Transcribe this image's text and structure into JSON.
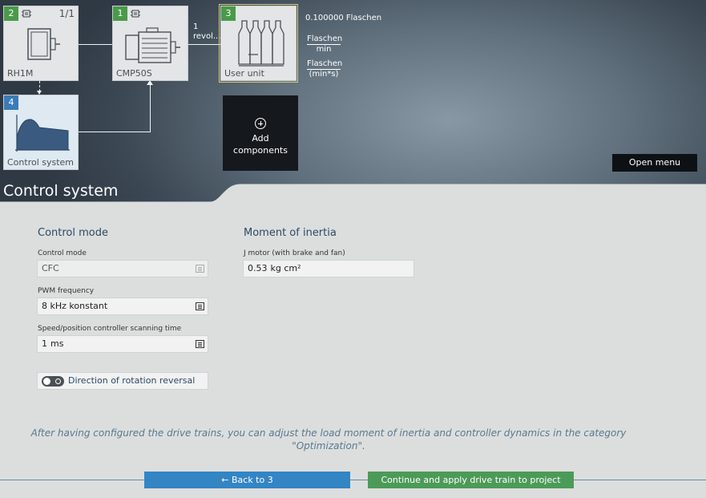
{
  "cards": {
    "encoder": {
      "num": "2",
      "label": "RH1M",
      "frac": "1/1"
    },
    "motor": {
      "num": "1",
      "label": "CMP50S"
    },
    "user_unit": {
      "num": "3",
      "label": "User unit"
    },
    "control_system": {
      "num": "4",
      "label": "Control system"
    }
  },
  "link_text": {
    "line1": "1",
    "line2": "revol..."
  },
  "user_unit_values": {
    "quantity": "0.100000 Flaschen",
    "rate_num": "Flaschen",
    "rate_den": "min",
    "accel_num": "Flaschen",
    "accel_den": "(min*s)"
  },
  "add_components": {
    "line1": "Add",
    "line2": "components"
  },
  "open_menu_label": "Open menu",
  "section_title": "Control system",
  "control_mode_section": {
    "heading": "Control mode",
    "control_mode_label": "Control mode",
    "control_mode_value": "CFC",
    "pwm_label": "PWM frequency",
    "pwm_value": "8 kHz konstant",
    "scan_label": "Speed/position controller scanning time",
    "scan_value": "1",
    "scan_unit": "ms",
    "rotation_label": "Direction of rotation reversal"
  },
  "inertia_section": {
    "heading": "Moment of inertia",
    "j_label": "J motor (with brake and fan)",
    "j_value": "0.53",
    "j_unit": "kg cm²"
  },
  "note_line1": "After having configured the drive trains, you can adjust the load moment of inertia and controller dynamics in the category",
  "note_line2": "\"Optimization\".",
  "buttons": {
    "back": "← Back to 3",
    "continue": "Continue and apply drive train to project"
  },
  "colors": {
    "green_badge": "#4a9a4a",
    "blue_badge": "#3a7bb8",
    "back_button": "#3385c4",
    "continue_button": "#4c9a58"
  }
}
